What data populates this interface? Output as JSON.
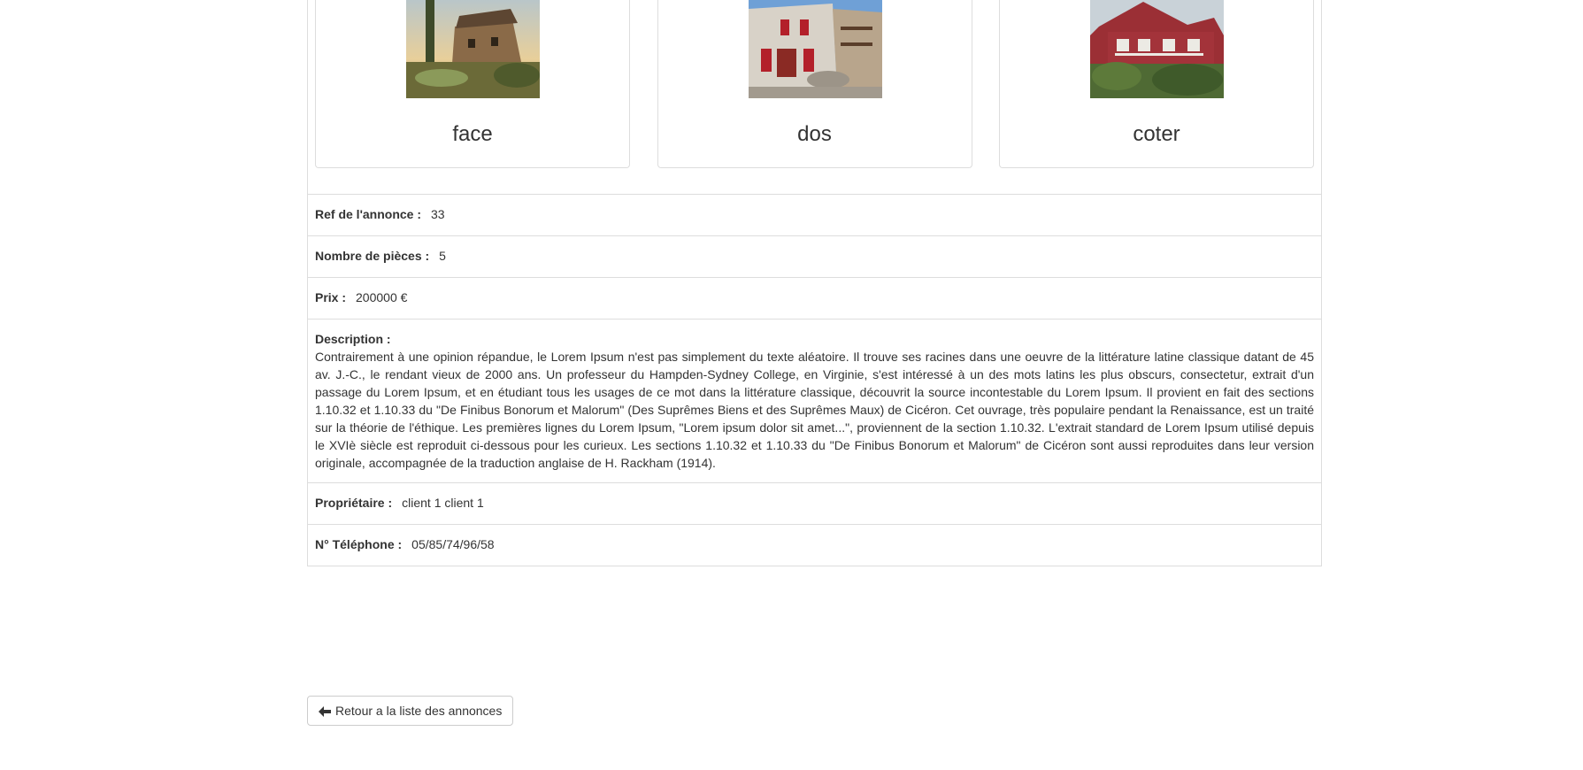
{
  "photos": [
    {
      "caption": "face",
      "icon": "house-photo-icon"
    },
    {
      "caption": "dos",
      "icon": "house-photo-icon"
    },
    {
      "caption": "coter",
      "icon": "house-photo-icon"
    }
  ],
  "details": {
    "ref_label": "Ref de l'annonce :",
    "ref_value": "33",
    "rooms_label": "Nombre de pièces :",
    "rooms_value": "5",
    "price_label": "Prix :",
    "price_value": "200000 €",
    "description_label": "Description :",
    "description_value": "Contrairement à une opinion répandue, le Lorem Ipsum n'est pas simplement du texte aléatoire. Il trouve ses racines dans une oeuvre de la littérature latine classique datant de 45 av. J.-C., le rendant vieux de 2000 ans. Un professeur du Hampden-Sydney College, en Virginie, s'est intéressé à un des mots latins les plus obscurs, consectetur, extrait d'un passage du Lorem Ipsum, et en étudiant tous les usages de ce mot dans la littérature classique, découvrit la source incontestable du Lorem Ipsum. Il provient en fait des sections 1.10.32 et 1.10.33 du \"De Finibus Bonorum et Malorum\" (Des Suprêmes Biens et des Suprêmes Maux) de Cicéron. Cet ouvrage, très populaire pendant la Renaissance, est un traité sur la théorie de l'éthique. Les premières lignes du Lorem Ipsum, \"Lorem ipsum dolor sit amet...\", proviennent de la section 1.10.32. L'extrait standard de Lorem Ipsum utilisé depuis le XVIè siècle est reproduit ci-dessous pour les curieux. Les sections 1.10.32 et 1.10.33 du \"De Finibus Bonorum et Malorum\" de Cicéron sont aussi reproduites dans leur version originale, accompagnée de la traduction anglaise de H. Rackham (1914).",
    "owner_label": "Propriétaire :",
    "owner_value": "client 1 client 1",
    "phone_label": "N° Téléphone :",
    "phone_value": "05/85/74/96/58"
  },
  "back_button": {
    "label": "Retour a la liste des annonces",
    "icon": "arrow-left-icon"
  }
}
